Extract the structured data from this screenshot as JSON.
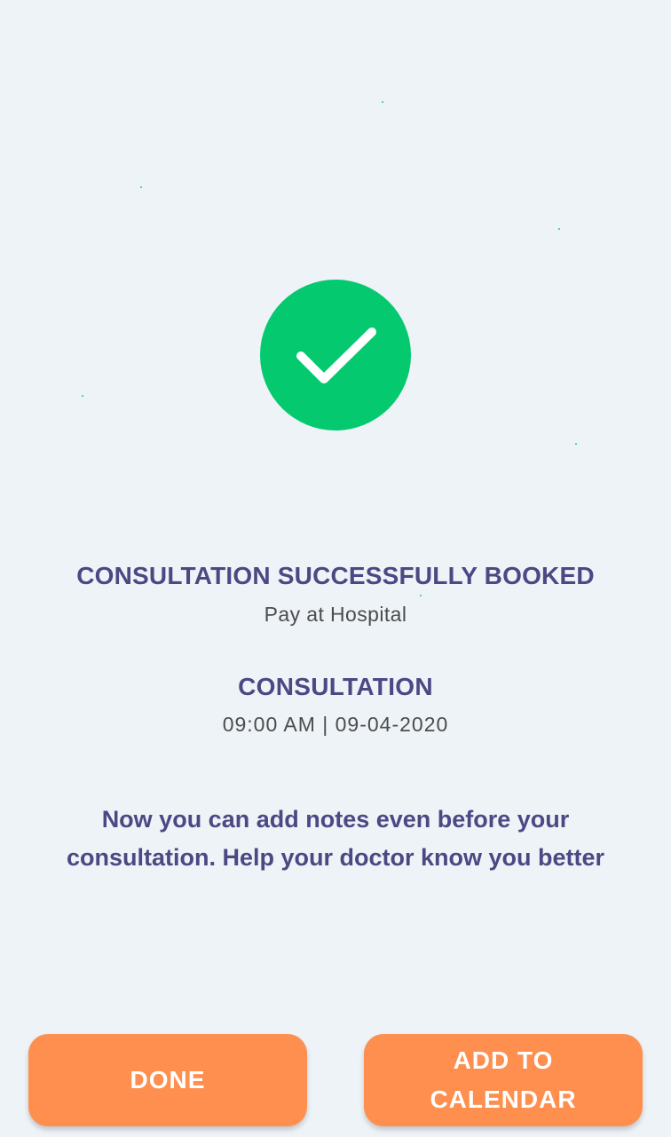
{
  "confirmation": {
    "status_icon": "check-icon",
    "status_color": "#04c96f",
    "title": "CONSULTATION SUCCESSFULLY BOOKED",
    "payment_mode": "Pay at Hospital"
  },
  "appointment": {
    "type": "CONSULTATION",
    "datetime": "09:00 AM | 09-04-2020"
  },
  "notes_prompt": "Now you can add notes even before your consultation. Help your doctor know you better",
  "actions": {
    "done_label": "DONE",
    "add_to_calendar_label": "ADD TO CALENDAR",
    "button_color": "#ff8f4e"
  }
}
